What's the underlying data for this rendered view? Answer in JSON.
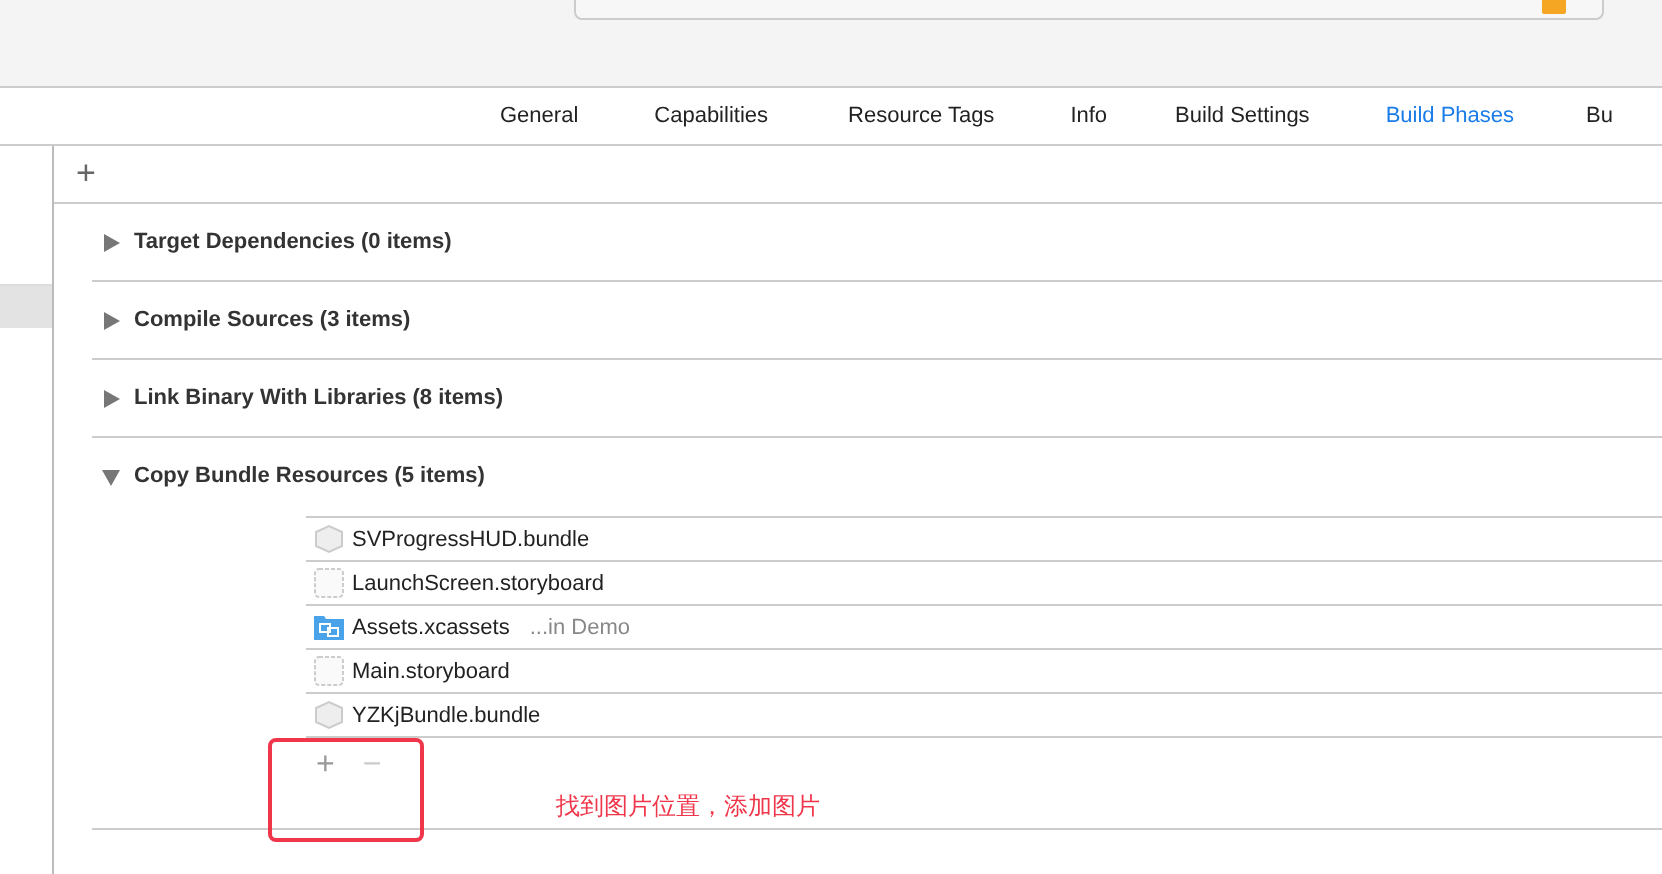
{
  "tabs": [
    {
      "label": "General",
      "selected": false
    },
    {
      "label": "Capabilities",
      "selected": false
    },
    {
      "label": "Resource Tags",
      "selected": false
    },
    {
      "label": "Info",
      "selected": false
    },
    {
      "label": "Build Settings",
      "selected": false
    },
    {
      "label": "Build Phases",
      "selected": true
    },
    {
      "label": "Bu",
      "selected": false
    }
  ],
  "add_symbol": "+",
  "phases": [
    {
      "title": "Target Dependencies (0 items)",
      "expanded": false
    },
    {
      "title": "Compile Sources (3 items)",
      "expanded": false
    },
    {
      "title": "Link Binary With Libraries (8 items)",
      "expanded": false
    },
    {
      "title": "Copy Bundle Resources (5 items)",
      "expanded": true,
      "files": [
        {
          "name": "SVProgressHUD.bundle",
          "kind": "bundle"
        },
        {
          "name": "LaunchScreen.storyboard",
          "kind": "storyboard"
        },
        {
          "name": "Assets.xcassets",
          "kind": "assets",
          "location": "...in Demo"
        },
        {
          "name": "Main.storyboard",
          "kind": "storyboard"
        },
        {
          "name": "YZKjBundle.bundle",
          "kind": "bundle"
        }
      ],
      "add_button": "+",
      "remove_button": "−"
    }
  ],
  "annotation": "找到图片位置，添加图片"
}
